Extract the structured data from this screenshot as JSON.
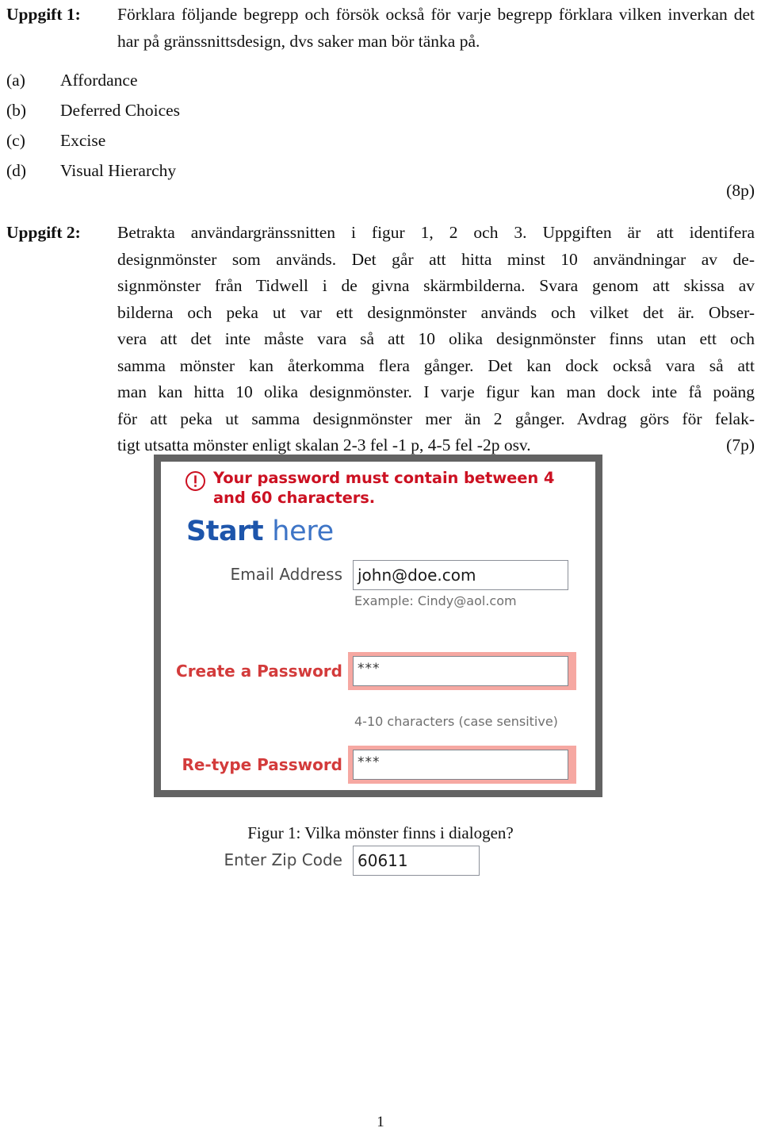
{
  "document": {
    "page_number": "1"
  },
  "task1": {
    "label": "Uppgift 1:",
    "body": "Förklara följande begrepp och försök också för varje begrepp förklara vilken inverkan det har på gränssnittsdesign, dvs saker man bör tänka på.",
    "items": [
      {
        "marker": "(a)",
        "text": "Affordance"
      },
      {
        "marker": "(b)",
        "text": "Deferred Choices"
      },
      {
        "marker": "(c)",
        "text": "Excise"
      },
      {
        "marker": "(d)",
        "text": "Visual Hierarchy"
      }
    ],
    "points": "(8p)"
  },
  "task2": {
    "label": "Uppgift 2:",
    "lines": [
      "Betrakta användargränssnitten i figur 1, 2 och 3. Uppgiften är att identifera",
      "designmönster som används. Det går att hitta minst 10 användningar av de-",
      "signmönster från Tidwell i de givna skärmbilderna. Svara genom att skissa av",
      "bilderna och peka ut var ett designmönster används och vilket det är. Obser-",
      "vera att det inte måste vara så att 10 olika designmönster finns utan ett och",
      "samma mönster kan återkomma flera gånger. Det kan dock också vara så att",
      "man kan hitta 10 olika designmönster. I varje figur kan man dock inte få poäng",
      "för att peka ut samma designmönster mer än 2 gånger. Avdrag görs för felak-"
    ],
    "last_line": "tigt utsatta mönster enligt skalan 2-3 fel -1 p, 4-5 fel -2p osv.",
    "points": "(7p)"
  },
  "figure": {
    "caption": "Figur 1: Vilka mönster finns i dialogen?",
    "screenshot": {
      "alert": {
        "icon": "warning-circle-icon",
        "text": "Your password must contain between 4 and 60 characters.",
        "color": "#cc1122"
      },
      "brand": {
        "bold_part": "Start",
        "light_part": "here",
        "bold_color": "#1d55ab",
        "light_color": "#3d74c6"
      },
      "fields": [
        {
          "label": "Email Address",
          "value": "john@doe.com",
          "placeholder": "Email Address",
          "hint": "Example: Cindy@aol.com",
          "error": false
        },
        {
          "label": "Create a Password",
          "value": "***",
          "placeholder": "Create a Password",
          "hint": "",
          "error": true
        },
        {
          "label": "Re-type Password",
          "value": "***",
          "placeholder": "Re-type Password",
          "hint": "4-10 characters (case sensitive)",
          "error": true
        },
        {
          "label": "Enter Zip Code",
          "value": "60611",
          "placeholder": "Enter Zip Code",
          "hint": "",
          "error": false
        }
      ],
      "error_band_color": "#f6a8a2",
      "frame_color": "#636363"
    }
  }
}
